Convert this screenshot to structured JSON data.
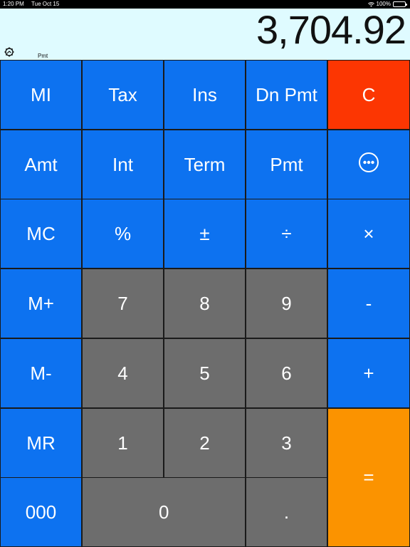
{
  "status_bar": {
    "time": "1:20 PM",
    "date": "Tue Oct 15",
    "battery": "100%"
  },
  "display": {
    "value": "3,704.92",
    "mode": "Pmt"
  },
  "keys": [
    {
      "id": "mi",
      "label": "MI",
      "color": "blue",
      "r": 0,
      "c": 0
    },
    {
      "id": "tax",
      "label": "Tax",
      "color": "blue",
      "r": 0,
      "c": 1
    },
    {
      "id": "ins",
      "label": "Ins",
      "color": "blue",
      "r": 0,
      "c": 2
    },
    {
      "id": "dn-pmt",
      "label": "Dn Pmt",
      "color": "blue",
      "r": 0,
      "c": 3
    },
    {
      "id": "clear",
      "label": "C",
      "color": "red",
      "r": 0,
      "c": 4
    },
    {
      "id": "amt",
      "label": "Amt",
      "color": "blue",
      "r": 1,
      "c": 0
    },
    {
      "id": "int",
      "label": "Int",
      "color": "blue",
      "r": 1,
      "c": 1
    },
    {
      "id": "term",
      "label": "Term",
      "color": "blue",
      "r": 1,
      "c": 2
    },
    {
      "id": "pmt",
      "label": "Pmt",
      "color": "blue",
      "r": 1,
      "c": 3
    },
    {
      "id": "more",
      "label": "",
      "icon": "more-icon",
      "color": "blue",
      "r": 1,
      "c": 4
    },
    {
      "id": "mc",
      "label": "MC",
      "color": "blue",
      "r": 2,
      "c": 0
    },
    {
      "id": "percent",
      "label": "%",
      "color": "blue",
      "r": 2,
      "c": 1
    },
    {
      "id": "plus-minus",
      "label": "±",
      "color": "blue",
      "r": 2,
      "c": 2
    },
    {
      "id": "divide",
      "label": "÷",
      "color": "blue",
      "r": 2,
      "c": 3
    },
    {
      "id": "multiply",
      "label": "×",
      "color": "blue",
      "r": 2,
      "c": 4
    },
    {
      "id": "m-plus",
      "label": "M+",
      "color": "blue",
      "r": 3,
      "c": 0
    },
    {
      "id": "7",
      "label": "7",
      "color": "gray",
      "r": 3,
      "c": 1
    },
    {
      "id": "8",
      "label": "8",
      "color": "gray",
      "r": 3,
      "c": 2
    },
    {
      "id": "9",
      "label": "9",
      "color": "gray",
      "r": 3,
      "c": 3
    },
    {
      "id": "minus",
      "label": "-",
      "color": "blue",
      "r": 3,
      "c": 4
    },
    {
      "id": "m-minus",
      "label": "M-",
      "color": "blue",
      "r": 4,
      "c": 0
    },
    {
      "id": "4",
      "label": "4",
      "color": "gray",
      "r": 4,
      "c": 1
    },
    {
      "id": "5",
      "label": "5",
      "color": "gray",
      "r": 4,
      "c": 2
    },
    {
      "id": "6",
      "label": "6",
      "color": "gray",
      "r": 4,
      "c": 3
    },
    {
      "id": "plus",
      "label": "+",
      "color": "blue",
      "r": 4,
      "c": 4
    },
    {
      "id": "mr",
      "label": "MR",
      "color": "blue",
      "r": 5,
      "c": 0
    },
    {
      "id": "1",
      "label": "1",
      "color": "gray",
      "r": 5,
      "c": 1
    },
    {
      "id": "2",
      "label": "2",
      "color": "gray",
      "r": 5,
      "c": 2
    },
    {
      "id": "3",
      "label": "3",
      "color": "gray",
      "r": 5,
      "c": 3
    },
    {
      "id": "equals",
      "label": "=",
      "color": "orange",
      "r": 5,
      "c": 4,
      "rs": 2
    },
    {
      "id": "000",
      "label": "000",
      "color": "blue",
      "r": 6,
      "c": 0
    },
    {
      "id": "0",
      "label": "0",
      "color": "gray",
      "r": 6,
      "c": 1,
      "cs": 2,
      "align": "left"
    },
    {
      "id": "decimal",
      "label": ".",
      "color": "gray",
      "r": 6,
      "c": 3
    }
  ],
  "colors": {
    "blue": "#0d72f0",
    "gray": "#6d6d6d",
    "red": "#fc3602",
    "orange": "#fb9300",
    "display_bg": "#dffbff"
  }
}
